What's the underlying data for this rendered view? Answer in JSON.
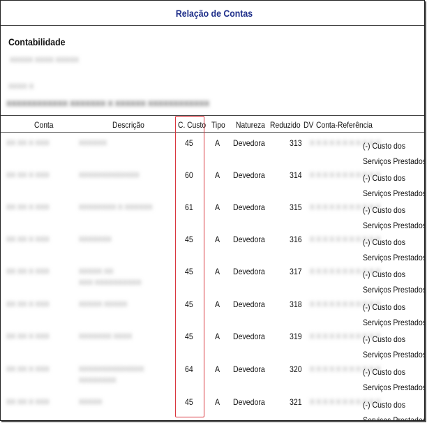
{
  "report": {
    "title": "Relação de Contas",
    "company": "Contabilidade",
    "blurred_lines": [
      "XXXXX XXXX XXXXX",
      "XXXX  X",
      "XXXXXXXXXXXX  XXXXXXX X XXXXXX XXXXXXXXXXXX"
    ]
  },
  "table": {
    "headers": {
      "conta": "Conta",
      "descricao": "Descrição",
      "ccusto": "C. Custo",
      "tipo": "Tipo",
      "natureza": "Natureza",
      "reduzido": "Reduzido",
      "dv": "DV",
      "conta_ref": "Conta-Referência"
    },
    "rows": [
      {
        "conta": "XX XX X XXX",
        "desc": "XXXXXX",
        "desc2": "",
        "ccusto": "45",
        "tipo": "A",
        "natureza": "Devedora",
        "reduzido": "313",
        "dvref": "X X X X X X X X X X X",
        "ref1": "(-) Custo dos",
        "ref2": "Serviços Prestados"
      },
      {
        "conta": "XX XX X XXX",
        "desc": "XXXXXXXXXXXXX",
        "desc2": "",
        "ccusto": "60",
        "tipo": "A",
        "natureza": "Devedora",
        "reduzido": "314",
        "dvref": "X X X X X X X X X X X",
        "ref1": "(-) Custo dos",
        "ref2": "Serviços Prestados"
      },
      {
        "conta": "XX XX X XXX",
        "desc": "XXXXXXXX X XXXXXX",
        "desc2": "",
        "ccusto": "61",
        "tipo": "A",
        "natureza": "Devedora",
        "reduzido": "315",
        "dvref": "X X X X X X X X X X X",
        "ref1": "(-) Custo dos",
        "ref2": "Serviços Prestados"
      },
      {
        "conta": "XX XX X XXX",
        "desc": "XXXXXXX",
        "desc2": "",
        "ccusto": "45",
        "tipo": "A",
        "natureza": "Devedora",
        "reduzido": "316",
        "dvref": "X X X X X X X X X X X",
        "ref1": "(-) Custo dos",
        "ref2": "Serviços Prestados"
      },
      {
        "conta": "XX XX X XXX",
        "desc": "XXXXX XX",
        "desc2": "XXX XXXXXXXXXX",
        "ccusto": "45",
        "tipo": "A",
        "natureza": "Devedora",
        "reduzido": "317",
        "dvref": "X X X X X X X X X X X",
        "ref1": "(-) Custo dos",
        "ref2": "Serviços Prestados"
      },
      {
        "conta": "XX XX X XXX",
        "desc": "XXXXX XXXXX",
        "desc2": "",
        "ccusto": "45",
        "tipo": "A",
        "natureza": "Devedora",
        "reduzido": "318",
        "dvref": "X X X X X X X X X X X",
        "ref1": "(-) Custo dos",
        "ref2": "Serviços Prestados"
      },
      {
        "conta": "XX XX X XXX",
        "desc": "XXXXXXX XXXX",
        "desc2": "",
        "ccusto": "45",
        "tipo": "A",
        "natureza": "Devedora",
        "reduzido": "319",
        "dvref": "X X X X X X X X X X X",
        "ref1": "(-) Custo dos",
        "ref2": "Serviços Prestados"
      },
      {
        "conta": "XX XX X XXX",
        "desc": "XXXXXXXXXXXXXX",
        "desc2": "XXXXXXXX",
        "ccusto": "64",
        "tipo": "A",
        "natureza": "Devedora",
        "reduzido": "320",
        "dvref": "X X X X X X X X X X X",
        "ref1": "(-) Custo dos",
        "ref2": "Serviços Prestados"
      },
      {
        "conta": "XX XX X XXX",
        "desc": "XXXXX",
        "desc2": "",
        "ccusto": "45",
        "tipo": "A",
        "natureza": "Devedora",
        "reduzido": "321",
        "dvref": "X X X X X X X X X X X",
        "ref1": "(-) Custo dos",
        "ref2": "Serviços Prestados"
      }
    ]
  },
  "highlight": {
    "color": "#d9363e",
    "column": "ccusto"
  }
}
